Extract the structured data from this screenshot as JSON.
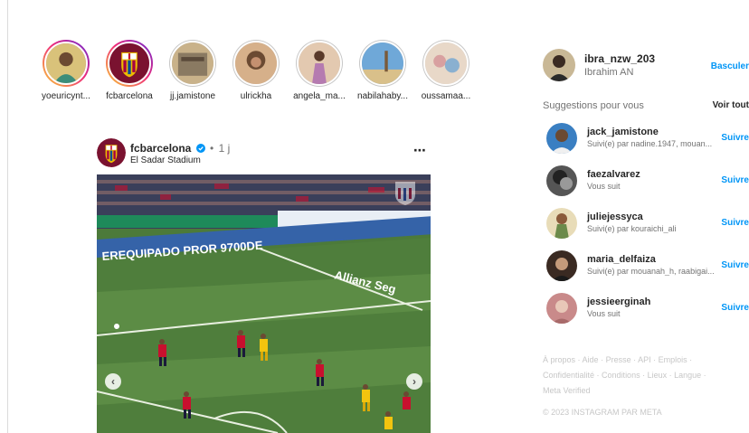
{
  "stories": [
    {
      "username": "yoeuricynt...",
      "seen": false,
      "colors": [
        "#d9c27a",
        "#3b8d7a"
      ]
    },
    {
      "username": "fcbarcelona",
      "seen": false,
      "colors": [
        "#a50044",
        "#004d98"
      ]
    },
    {
      "username": "jj.jamistone",
      "seen": true,
      "colors": [
        "#8a7a62",
        "#c9b28a"
      ]
    },
    {
      "username": "ulrickha",
      "seen": true,
      "colors": [
        "#6b4a32",
        "#d6b08a"
      ]
    },
    {
      "username": "angela_ma...",
      "seen": true,
      "colors": [
        "#b57bb0",
        "#e3c9b0"
      ]
    },
    {
      "username": "nabilahaby...",
      "seen": true,
      "colors": [
        "#6fa8d8",
        "#d9c08a"
      ]
    },
    {
      "username": "oussamaa...",
      "seen": true,
      "colors": [
        "#d8a0a0",
        "#8ab0d0"
      ]
    }
  ],
  "post": {
    "username": "fcbarcelona",
    "separator": "•",
    "time": "1 j",
    "location": "El Sadar Stadium",
    "more_icon": "⋯",
    "prev_icon": "‹",
    "next_icon": "›",
    "banner_text_left": "EREQUIPADO PROR 9700DE",
    "banner_text_right": "Allianz Seg",
    "colors": {
      "pitch": "#4f7e3c",
      "pitch_light": "#5c8c45",
      "stands": "#3a3f5a",
      "kit_red": "#c8102e",
      "kit_yellow": "#f2c40f"
    }
  },
  "sidebar": {
    "me": {
      "username": "ibra_nzw_203",
      "full_name": "Ibrahim AN",
      "switch_label": "Basculer"
    },
    "suggestions_title": "Suggestions pour vous",
    "see_all_label": "Voir tout",
    "suggestions": [
      {
        "username": "jack_jamistone",
        "subtitle": "Suivi(e) par nadine.1947, mouan...",
        "action": "Suivre",
        "colors": [
          "#3a7fc2",
          "#6b4a32"
        ]
      },
      {
        "username": "faezalvarez",
        "subtitle": "Vous suit",
        "action": "Suivre",
        "colors": [
          "#333333",
          "#999999"
        ]
      },
      {
        "username": "juliejessyca",
        "subtitle": "Suivi(e) par kouraichi_ali",
        "action": "Suivre",
        "colors": [
          "#d9c08a",
          "#6b8a4a"
        ]
      },
      {
        "username": "maria_delfaiza",
        "subtitle": "Suivi(e) par mouanah_h, raabigai...",
        "action": "Suivre",
        "colors": [
          "#3a2a22",
          "#c49a7a"
        ]
      },
      {
        "username": "jessieerginah",
        "subtitle": "Vous suit",
        "action": "Suivre",
        "colors": [
          "#c98a8a",
          "#e8c8b8"
        ]
      }
    ],
    "footer": {
      "links": [
        "À propos",
        "Aide",
        "Presse",
        "API",
        "Emplois",
        "Confidentialité",
        "Conditions",
        "Lieux",
        "Langue",
        "Meta Verified"
      ],
      "copyright": "© 2023 INSTAGRAM PAR META"
    }
  },
  "accent": "#0095f6"
}
